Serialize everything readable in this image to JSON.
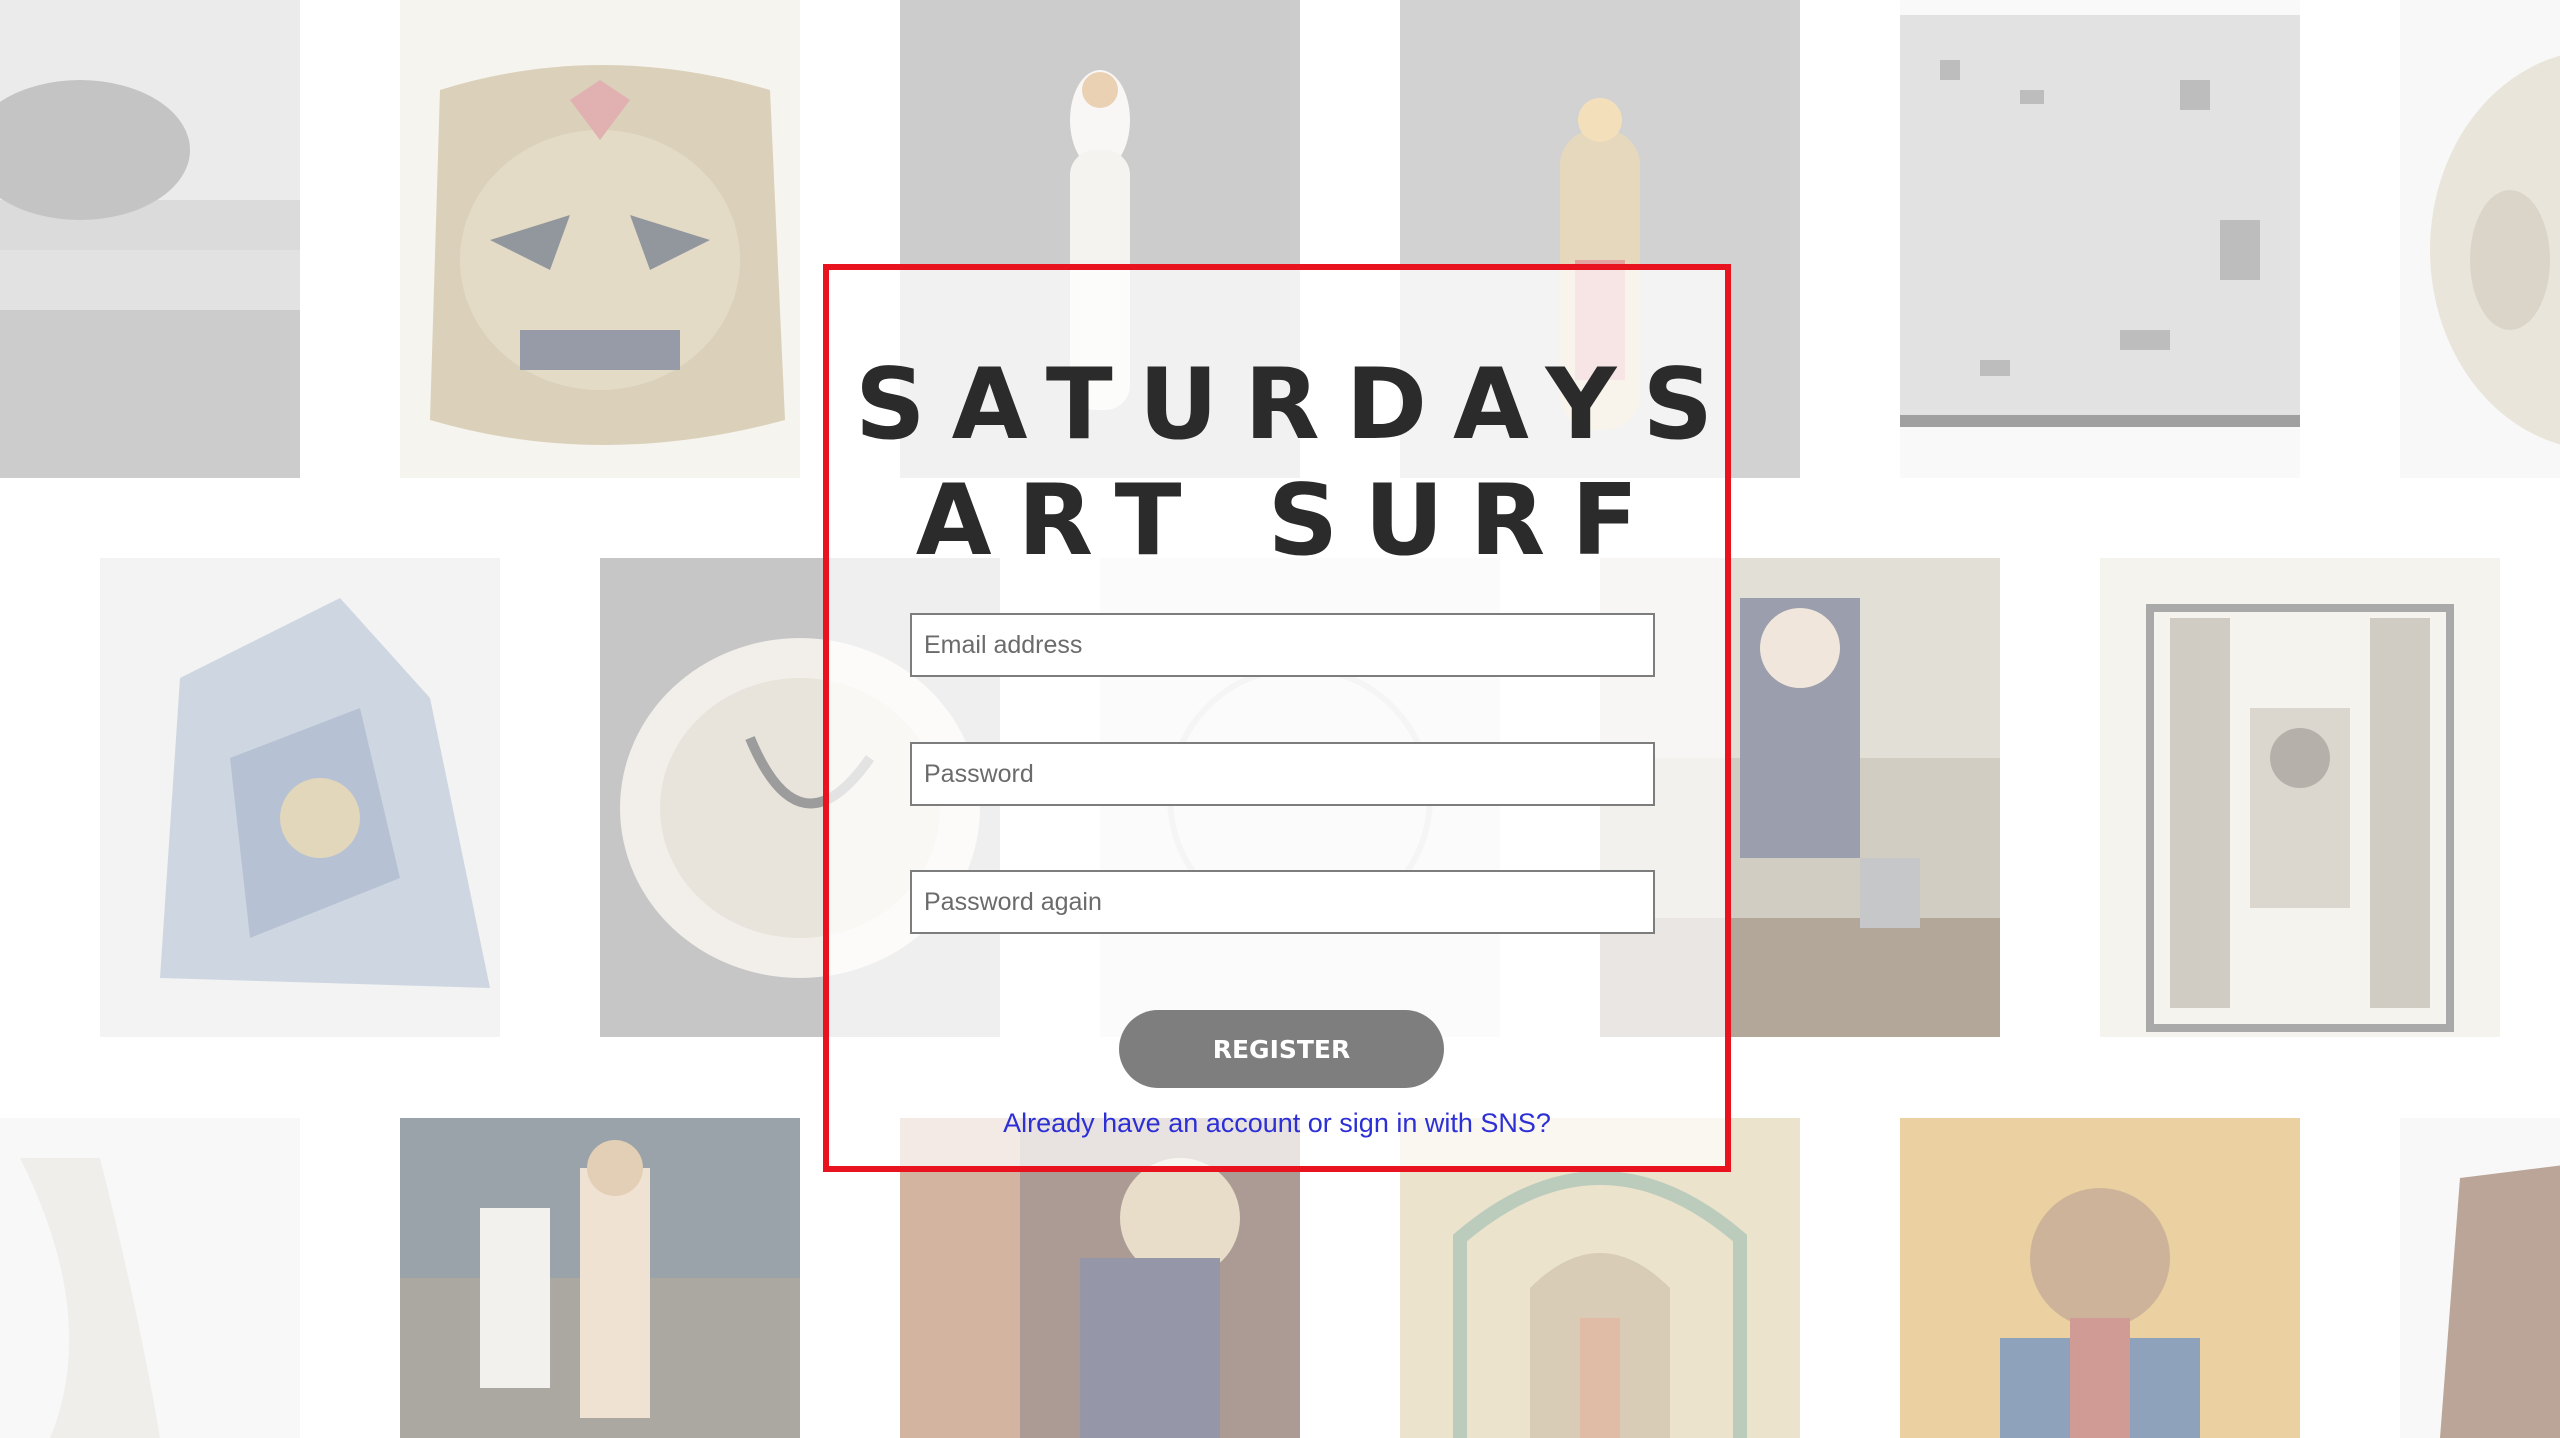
{
  "app": {
    "title_line1": "SATURDAYS",
    "title_line2": "ART SURF"
  },
  "form": {
    "email_placeholder": "Email address",
    "password_placeholder": "Password",
    "password_again_placeholder": "Password again",
    "register_label": "REGISTER",
    "signin_link": "Already have an account or sign in with SNS?"
  },
  "colors": {
    "card_border": "#e8131f",
    "button_bg": "#7e7e7e",
    "link": "#2d2fd6"
  }
}
